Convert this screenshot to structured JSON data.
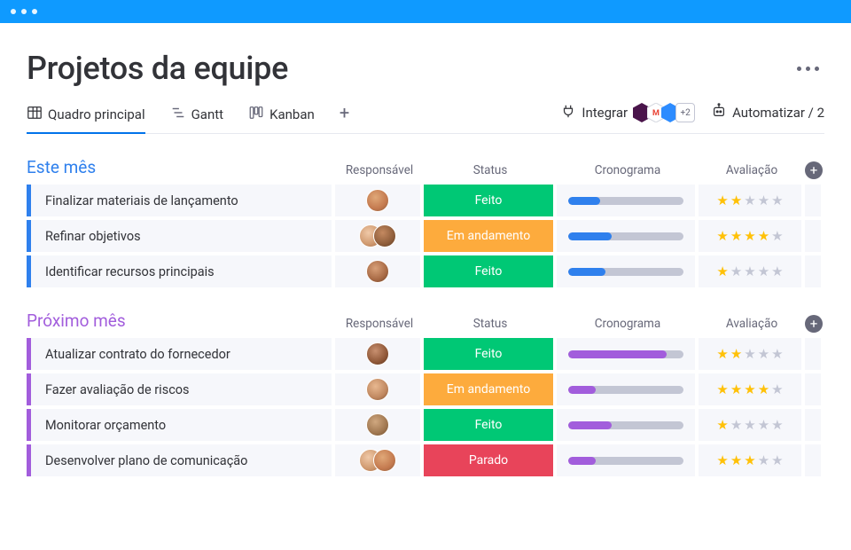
{
  "page_title": "Projetos da equipe",
  "tabs": {
    "main": "Quadro principal",
    "gantt": "Gantt",
    "kanban": "Kanban"
  },
  "actions": {
    "integrate": "Integrar",
    "automate": "Automatizar / 2",
    "integrations_more": "+2"
  },
  "columns": {
    "owner": "Responsável",
    "status": "Status",
    "timeline": "Cronograma",
    "rating": "Avaliação"
  },
  "status_labels": {
    "done": "Feito",
    "in_progress": "Em andamento",
    "stuck": "Parado"
  },
  "status_colors": {
    "done": "#00c875",
    "in_progress": "#fdab3d",
    "stuck": "#e8445a"
  },
  "groups": [
    {
      "title": "Este mês",
      "color": "#2f80ed",
      "timeline_color": "#2f80ed",
      "items": [
        {
          "task": "Finalizar materiais de lançamento",
          "owners": [
            "av1"
          ],
          "status": "done",
          "progress": 28,
          "rating": 2
        },
        {
          "task": "Refinar objetivos",
          "owners": [
            "av2",
            "av3"
          ],
          "status": "in_progress",
          "progress": 38,
          "rating": 4
        },
        {
          "task": "Identificar recursos principais",
          "owners": [
            "av4"
          ],
          "status": "done",
          "progress": 32,
          "rating": 1
        }
      ]
    },
    {
      "title": "Próximo mês",
      "color": "#a25ddc",
      "timeline_color": "#a25ddc",
      "items": [
        {
          "task": "Atualizar contrato do fornecedor",
          "owners": [
            "av5"
          ],
          "status": "done",
          "progress": 85,
          "rating": 2
        },
        {
          "task": "Fazer avaliação de riscos",
          "owners": [
            "av6"
          ],
          "status": "in_progress",
          "progress": 24,
          "rating": 4
        },
        {
          "task": "Monitorar orçamento",
          "owners": [
            "av7"
          ],
          "status": "done",
          "progress": 38,
          "rating": 1
        },
        {
          "task": "Desenvolver plano de comunicação",
          "owners": [
            "av2",
            "av1"
          ],
          "status": "stuck",
          "progress": 24,
          "rating": 3
        }
      ]
    }
  ]
}
